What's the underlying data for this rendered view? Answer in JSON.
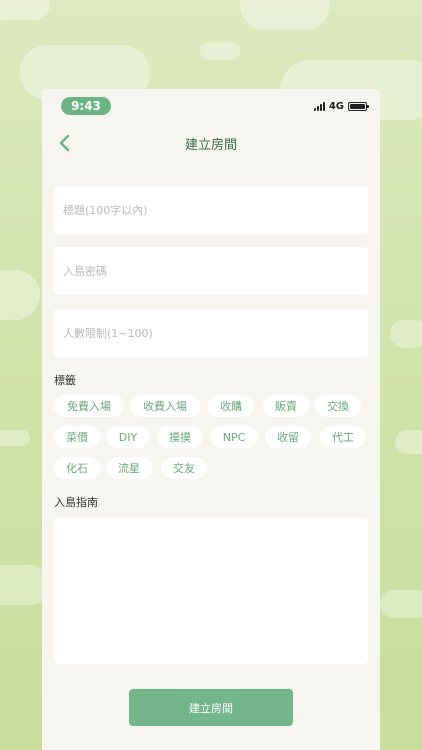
{
  "status_bar": {
    "time": "9:43",
    "network": "4G",
    "battery_level": 1.0
  },
  "nav": {
    "title": "建立房間",
    "back_icon": "chevron-left-icon"
  },
  "fields": {
    "title_placeholder": "標題(100字以內)",
    "password_placeholder": "入島密碼",
    "limit_placeholder": "人數限制(1~100)"
  },
  "tags": {
    "label": "標籤",
    "items": [
      "免費入場",
      "收費入場",
      "收購",
      "販賣",
      "交換",
      "菜價",
      "DIY",
      "摸摸",
      "NPC",
      "收留",
      "代工",
      "化石",
      "流星",
      "交友"
    ]
  },
  "guide": {
    "label": "入島指南",
    "value": ""
  },
  "submit_label": "建立房間",
  "colors": {
    "accent": "#72b68a",
    "background": "#cfe2a8",
    "card": "#f6f5ef"
  }
}
